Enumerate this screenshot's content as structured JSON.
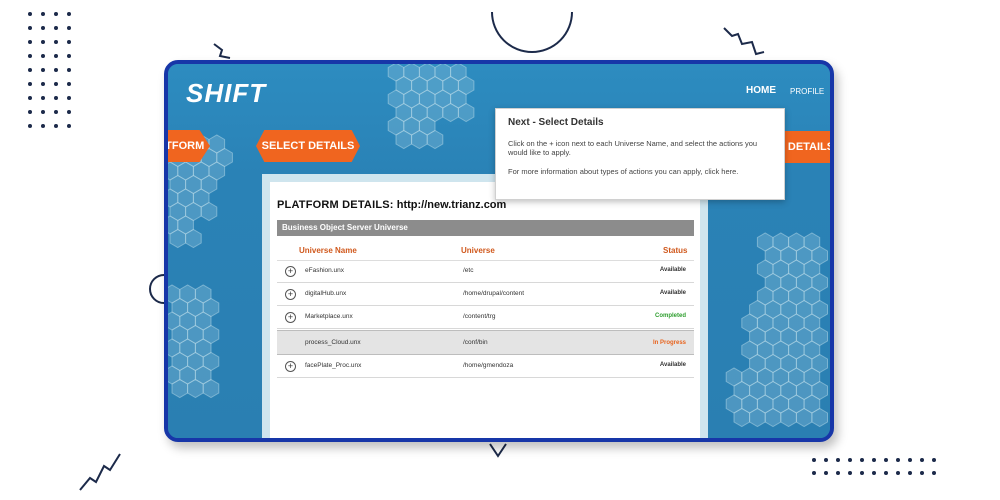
{
  "app": {
    "logo": "SHIFT"
  },
  "nav": {
    "home": "HOME",
    "profile": "PROFILE"
  },
  "steps": {
    "left": "ATFORM",
    "middle": "SELECT DETAILS",
    "right": "DETAILS"
  },
  "panel": {
    "title_label": "PLATFORM DETAILS:",
    "title_value": "http://new.trianz.com",
    "section": "Business Object Server Universe",
    "columns": {
      "name": "Universe Name",
      "universe": "Universe",
      "status": "Status"
    },
    "rows": [
      {
        "name": "eFashion.unx",
        "path": "/etc",
        "status": "Available",
        "status_color": "#333333"
      },
      {
        "name": "digitalHub.unx",
        "path": "/home/drupal/content",
        "status": "Available",
        "status_color": "#333333"
      },
      {
        "name": "Marketplace.unx",
        "path": "/content/trg",
        "status": "Completed",
        "status_color": "#2e9e2e"
      },
      {
        "name": "process_Cloud.unx",
        "path": "/conf/bin",
        "status": "In Progress",
        "status_color": "#e8641e"
      },
      {
        "name": "facePlate_Proc.unx",
        "path": "/home/gmendoza",
        "status": "Available",
        "status_color": "#333333"
      }
    ]
  },
  "popover": {
    "title": "Next - Select Details",
    "body": "Click on the + icon next to each Universe Name, and select the actions you would like to apply.",
    "body2": "For more information about types of actions you can apply, click here."
  },
  "colors": {
    "frame": "#1736a8",
    "accent": "#f0651f",
    "background": "#2a7eae"
  }
}
